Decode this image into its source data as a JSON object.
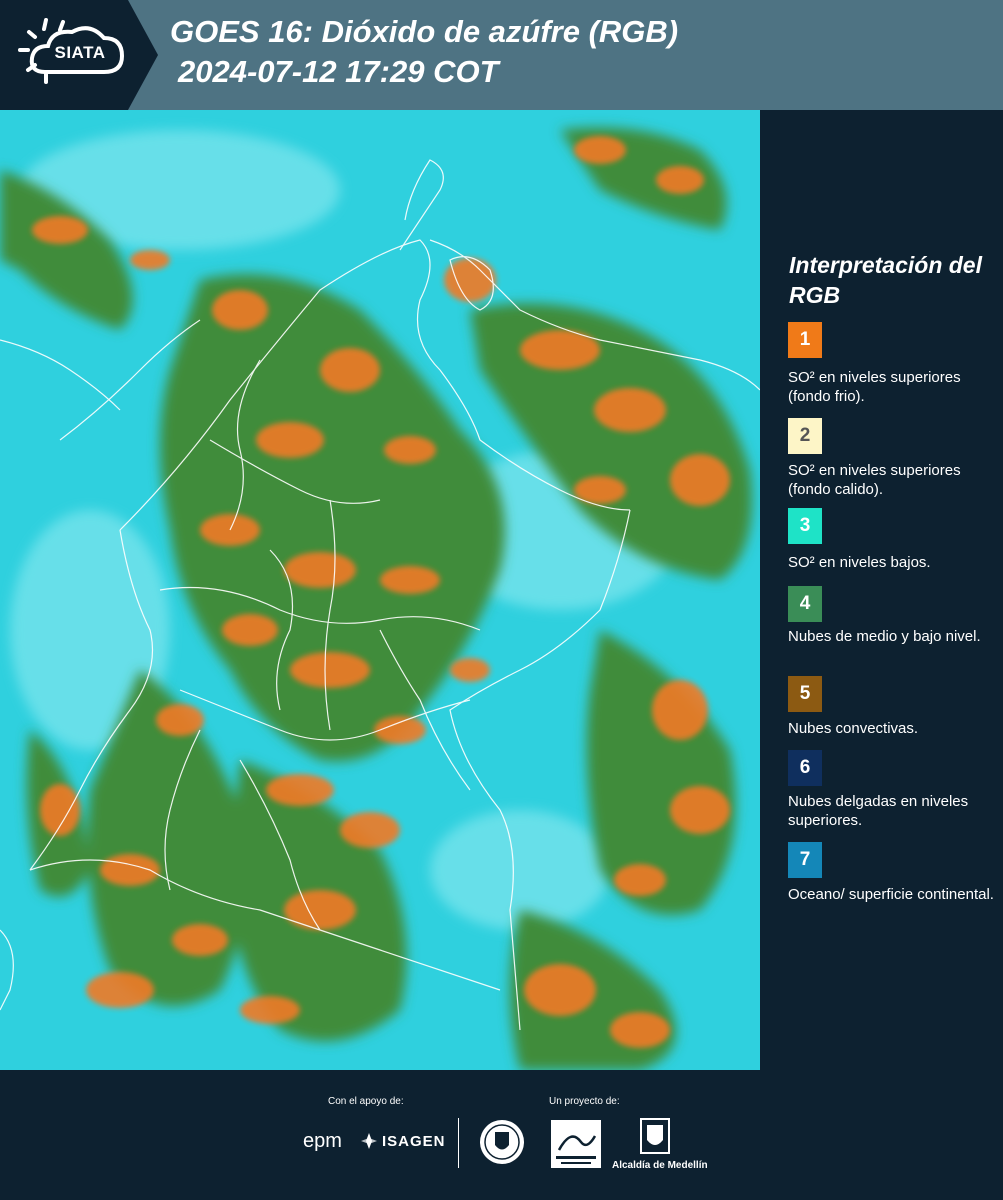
{
  "header": {
    "logo_text": "SIATA",
    "title_line1": "GOES 16: Dióxido de azúfre (RGB)",
    "title_line2": "2024-07-12 17:29 COT"
  },
  "legend": {
    "title": "Interpretación del RGB",
    "items": [
      {
        "number": "1",
        "label": "SO² en niveles superiores (fondo frio).",
        "color": "#f07a18",
        "text_color": "#ffffff"
      },
      {
        "number": "2",
        "label": "SO² en niveles superiores (fondo calido).",
        "color": "#fdf5c7",
        "text_color": "#555555"
      },
      {
        "number": "3",
        "label": "SO² en niveles bajos.",
        "color": "#1ee3c7",
        "text_color": "#ffffff"
      },
      {
        "number": "4",
        "label": "Nubes de medio y bajo nivel.",
        "color": "#3a8d57",
        "text_color": "#ffffff"
      },
      {
        "number": "5",
        "label": "Nubes convectivas.",
        "color": "#8c5a12",
        "text_color": "#ffffff"
      },
      {
        "number": "6",
        "label": "Nubes delgadas en niveles superiores.",
        "color": "#0f2f5e",
        "text_color": "#ffffff"
      },
      {
        "number": "7",
        "label": "Oceano/ superficie continental.",
        "color": "#1487b8",
        "text_color": "#ffffff"
      }
    ]
  },
  "footer": {
    "support_label": "Con el apoyo de:",
    "project_label": "Un proyecto de:",
    "epm": "epm",
    "isagen": "ISAGEN",
    "alcaldia": "Alcaldía de Medellín"
  },
  "colors": {
    "ocean": "#2fd0de",
    "cloud_green": "#3f8c3a",
    "cloud_orange": "#f07a28",
    "header": "#4e7383",
    "background": "#0d2130"
  }
}
